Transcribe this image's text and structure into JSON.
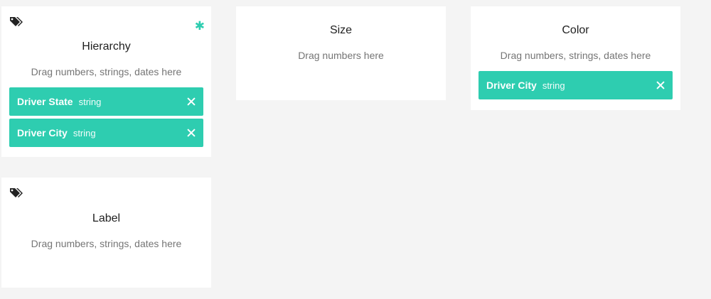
{
  "accent_color": "#2ecdb0",
  "cards": {
    "hierarchy": {
      "title": "Hierarchy",
      "hint": "Drag numbers, strings, dates here",
      "icon": "tags-icon",
      "required_icon": "asterisk-icon",
      "fields": [
        {
          "name": "Driver State",
          "type": "string"
        },
        {
          "name": "Driver City",
          "type": "string"
        }
      ]
    },
    "size": {
      "title": "Size",
      "hint": "Drag numbers here"
    },
    "color": {
      "title": "Color",
      "hint": "Drag numbers, strings, dates here",
      "fields": [
        {
          "name": "Driver City",
          "type": "string"
        }
      ]
    },
    "label": {
      "title": "Label",
      "hint": "Drag numbers, strings, dates here",
      "icon": "tags-icon"
    }
  }
}
